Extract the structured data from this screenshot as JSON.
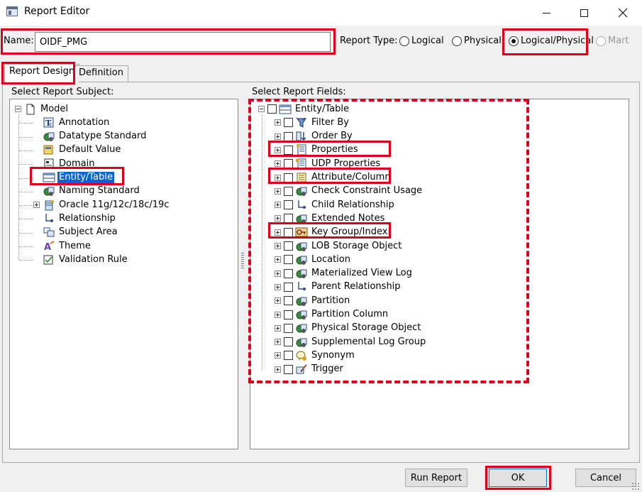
{
  "window": {
    "title": "Report Editor"
  },
  "form": {
    "name_label": "Name:",
    "name_value": "OIDF_PMG",
    "report_type_label": "Report Type:",
    "report_types": [
      {
        "label": "Logical",
        "checked": false,
        "disabled": false
      },
      {
        "label": "Physical",
        "checked": false,
        "disabled": false
      },
      {
        "label": "Logical/Physical",
        "checked": true,
        "disabled": false
      },
      {
        "label": "Mart",
        "checked": false,
        "disabled": true
      }
    ]
  },
  "tabs": [
    {
      "label": "Report Design",
      "active": true
    },
    {
      "label": "Definition",
      "active": false
    }
  ],
  "left_panel": {
    "title": "Select Report Subject:",
    "root": {
      "label": "Model",
      "icon": "document-icon",
      "expanded": true
    },
    "items": [
      {
        "label": "Annotation",
        "icon": "text-icon"
      },
      {
        "label": "Datatype Standard",
        "icon": "standard-icon"
      },
      {
        "label": "Default Value",
        "icon": "default-value-icon"
      },
      {
        "label": "Domain",
        "icon": "domain-icon"
      },
      {
        "label": "Entity/Table",
        "icon": "table-icon",
        "selected": true
      },
      {
        "label": "Naming Standard",
        "icon": "standard-icon"
      },
      {
        "label": "Oracle 11g/12c/18c/19c",
        "icon": "database-icon",
        "expandable": true
      },
      {
        "label": "Relationship",
        "icon": "relationship-icon"
      },
      {
        "label": "Subject Area",
        "icon": "subject-area-icon"
      },
      {
        "label": "Theme",
        "icon": "theme-icon"
      },
      {
        "label": "Validation Rule",
        "icon": "validation-icon"
      }
    ]
  },
  "right_panel": {
    "title": "Select Report Fields:",
    "root": {
      "label": "Entity/Table",
      "icon": "table-icon",
      "expanded": true
    },
    "items": [
      {
        "label": "Filter By",
        "icon": "filter-icon"
      },
      {
        "label": "Order By",
        "icon": "order-icon"
      },
      {
        "label": "Properties",
        "icon": "properties-icon"
      },
      {
        "label": "UDP Properties",
        "icon": "udp-icon"
      },
      {
        "label": "Attribute/Column",
        "icon": "column-icon"
      },
      {
        "label": "Check Constraint Usage",
        "icon": "object-icon"
      },
      {
        "label": "Child Relationship",
        "icon": "relationship-icon"
      },
      {
        "label": "Extended Notes",
        "icon": "object-icon"
      },
      {
        "label": "Key Group/Index",
        "icon": "key-icon"
      },
      {
        "label": "LOB Storage Object",
        "icon": "object-icon"
      },
      {
        "label": "Location",
        "icon": "object-icon"
      },
      {
        "label": "Materialized View Log",
        "icon": "object-icon"
      },
      {
        "label": "Parent Relationship",
        "icon": "relationship-icon"
      },
      {
        "label": "Partition",
        "icon": "object-icon"
      },
      {
        "label": "Partition Column",
        "icon": "object-icon"
      },
      {
        "label": "Physical Storage Object",
        "icon": "object-icon"
      },
      {
        "label": "Supplemental Log Group",
        "icon": "object-icon"
      },
      {
        "label": "Synonym",
        "icon": "synonym-icon"
      },
      {
        "label": "Trigger",
        "icon": "trigger-icon"
      }
    ]
  },
  "buttons": {
    "run_report": "Run Report",
    "ok": "OK",
    "cancel": "Cancel"
  },
  "colors": {
    "highlight": "#e0001b",
    "selection": "#0a64d6"
  }
}
